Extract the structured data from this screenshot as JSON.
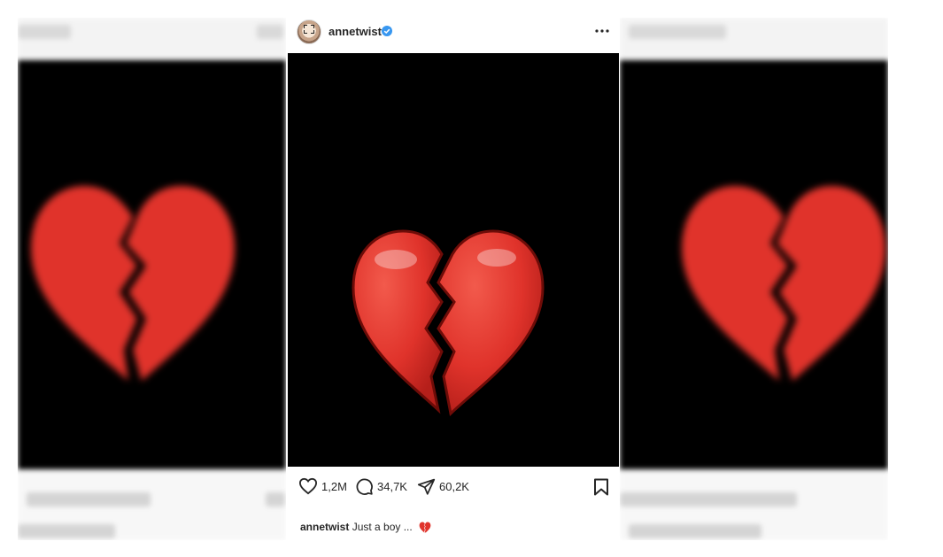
{
  "post": {
    "username": "annetwist",
    "verified": true,
    "more_icon": "more-horizontal-icon",
    "image_icon": "broken-heart-emoji",
    "likes": "1,2M",
    "comments": "34,7K",
    "shares": "60,2K",
    "caption_username": "annetwist",
    "caption_text": "Just a boy ...",
    "caption_emoji": "broken-heart-emoji"
  },
  "colors": {
    "heart_red": "#e0332b",
    "heart_dark": "#b51f1a",
    "verified_blue": "#3897f0",
    "image_bg": "#000000",
    "text": "#262626"
  }
}
